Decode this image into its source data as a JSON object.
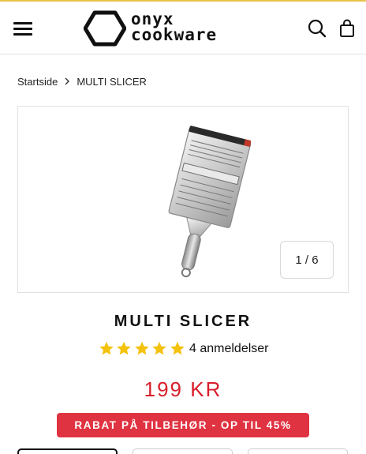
{
  "header": {
    "brand_line1": "onyx",
    "brand_line2": "cookware",
    "menu_icon": "hamburger-icon",
    "search_icon": "search-icon",
    "cart_icon": "shopping-bag-icon"
  },
  "breadcrumb": {
    "home": "Startside",
    "current": "MULTI SLICER"
  },
  "gallery": {
    "counter": "1 / 6"
  },
  "product": {
    "title": "MULTI SLICER",
    "rating_stars": 5,
    "reviews_label": "4 anmeldelser",
    "price": "199 KR"
  },
  "promo": {
    "text": "RABAT PÅ TILBEHØR - OP TIL",
    "percent": "45%"
  },
  "colors": {
    "price": "#d81e2c",
    "promo_bg": "#e03341",
    "stars": "#f4c20d"
  }
}
